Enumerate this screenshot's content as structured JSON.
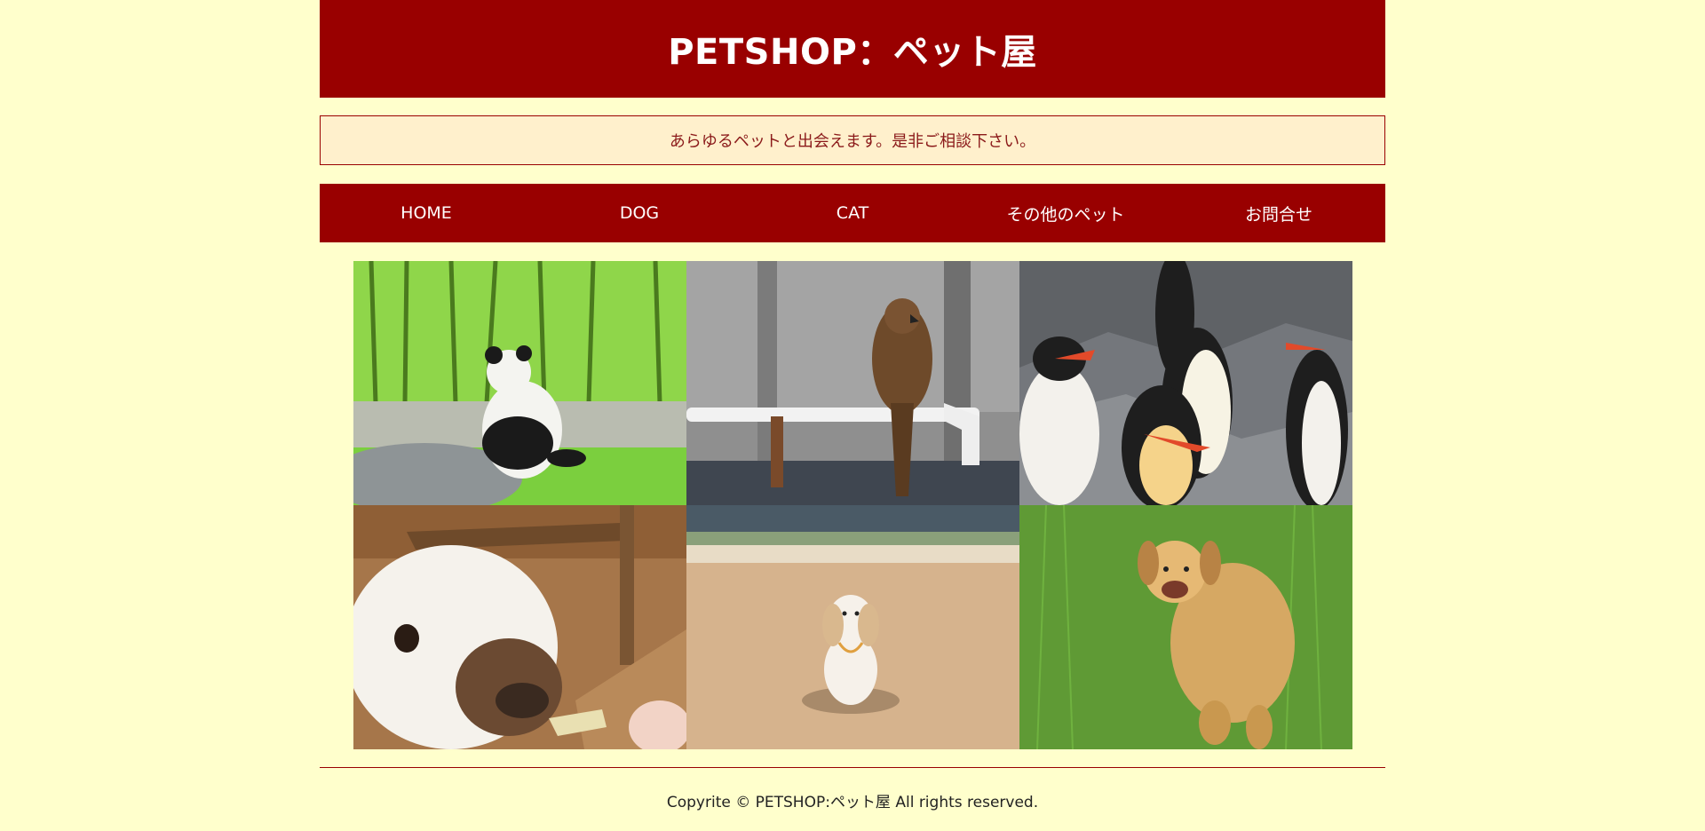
{
  "site": {
    "title": "PETSHOP：ペット屋",
    "tagline": "あらゆるペットと出会えます。是非ご相談下さい。"
  },
  "nav": {
    "items": [
      {
        "label": "HOME"
      },
      {
        "label": "DOG"
      },
      {
        "label": "CAT"
      },
      {
        "label": "その他のペット"
      },
      {
        "label": "お問合せ"
      }
    ]
  },
  "gallery": {
    "photos": [
      {
        "subject": "panda",
        "icon": "panda-photo"
      },
      {
        "subject": "hawk",
        "icon": "hawk-photo"
      },
      {
        "subject": "penguins",
        "icon": "penguins-photo"
      },
      {
        "subject": "llama",
        "icon": "llama-photo"
      },
      {
        "subject": "poodle",
        "icon": "poodle-photo"
      },
      {
        "subject": "golden-retriever",
        "icon": "golden-retriever-photo"
      }
    ]
  },
  "footer": {
    "copyright": "Copyrite © PETSHOP:ペット屋 All rights reserved."
  },
  "colors": {
    "background": "#ffffcc",
    "brand": "#990000",
    "tagline_bg": "#fff0cc"
  }
}
